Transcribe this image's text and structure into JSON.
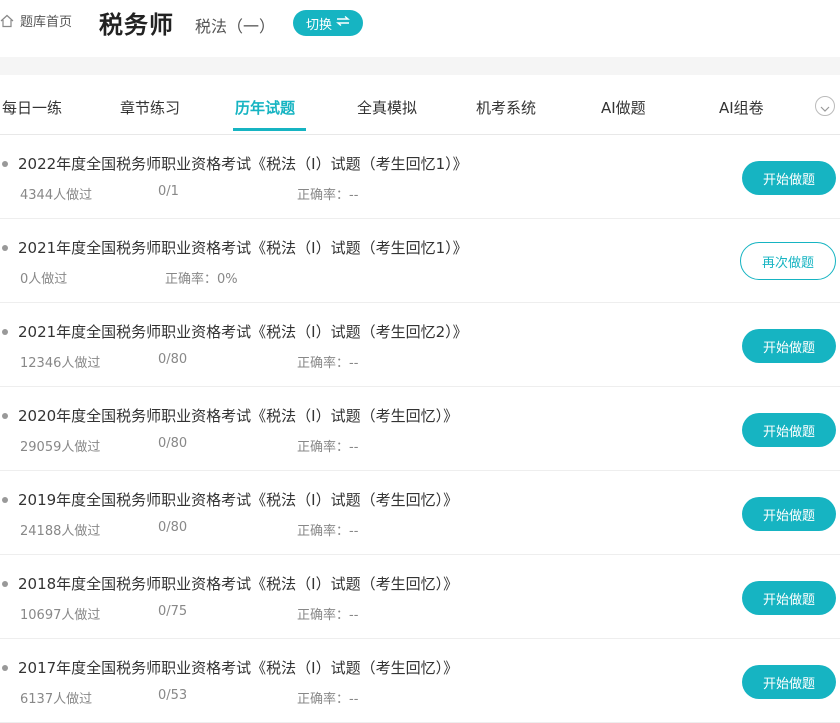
{
  "header": {
    "home_label": "题库首页",
    "subject": "税务师",
    "subsubject": "税法（一）",
    "switch_label": "切换"
  },
  "tabs": [
    {
      "label": "每日一练",
      "active": false
    },
    {
      "label": "章节练习",
      "active": false
    },
    {
      "label": "历年试题",
      "active": true
    },
    {
      "label": "全真模拟",
      "active": false
    },
    {
      "label": "机考系统",
      "active": false
    },
    {
      "label": "AI做题",
      "active": false
    },
    {
      "label": "AI组卷",
      "active": false
    }
  ],
  "accent_color": "#16b4c2",
  "items": [
    {
      "title": "2022年度全国税务师职业资格考试《税法（Ⅰ）试题（考生回忆1）》",
      "count": "4344人做过",
      "progress": "0/1",
      "accuracy": "正确率：--",
      "action": "开始做题"
    },
    {
      "title": "2021年度全国税务师职业资格考试《税法（Ⅰ）试题（考生回忆1）》",
      "count": "0人做过",
      "progress": "",
      "accuracy": "正确率：0%",
      "action": "再次做题"
    },
    {
      "title": "2021年度全国税务师职业资格考试《税法（Ⅰ）试题（考生回忆2）》",
      "count": "12346人做过",
      "progress": "0/80",
      "accuracy": "正确率：--",
      "action": "开始做题"
    },
    {
      "title": "2020年度全国税务师职业资格考试《税法（Ⅰ）试题（考生回忆）》",
      "count": "29059人做过",
      "progress": "0/80",
      "accuracy": "正确率：--",
      "action": "开始做题"
    },
    {
      "title": "2019年度全国税务师职业资格考试《税法（Ⅰ）试题（考生回忆）》",
      "count": "24188人做过",
      "progress": "0/80",
      "accuracy": "正确率：--",
      "action": "开始做题"
    },
    {
      "title": "2018年度全国税务师职业资格考试《税法（Ⅰ）试题（考生回忆）》",
      "count": "10697人做过",
      "progress": "0/75",
      "accuracy": "正确率：--",
      "action": "开始做题"
    },
    {
      "title": "2017年度全国税务师职业资格考试《税法（Ⅰ）试题（考生回忆）》",
      "count": "6137人做过",
      "progress": "0/53",
      "accuracy": "正确率：--",
      "action": "开始做题"
    }
  ]
}
